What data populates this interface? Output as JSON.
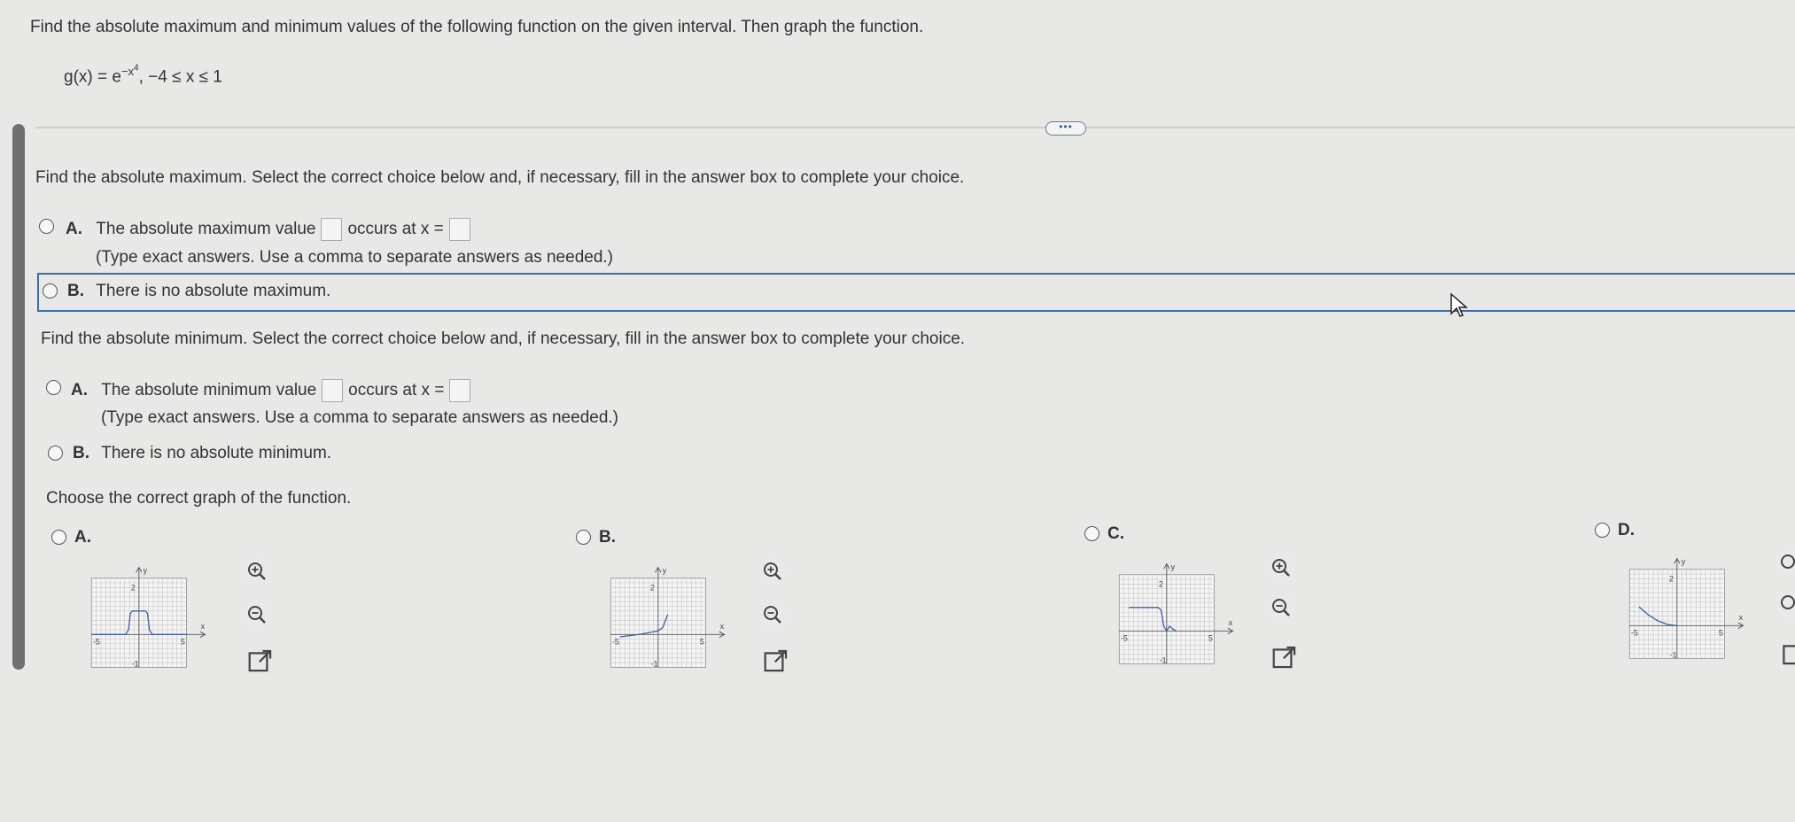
{
  "problem": {
    "instruction": "Find the absolute maximum and minimum values of the following function on the given interval. Then graph the function.",
    "function_lhs": "g(x) = e",
    "exponent": "−x",
    "exponent_power": "4",
    "interval": ", −4 ≤ x ≤ 1"
  },
  "more_button": "•••",
  "maximum": {
    "prompt": "Find the absolute maximum. Select the correct choice below and, if necessary, fill in the answer box to complete your choice.",
    "a_letter": "A.",
    "a_text1": "The absolute maximum value",
    "a_text2": "occurs at x =",
    "a_hint": "(Type exact answers. Use a comma to separate answers as needed.)",
    "b_letter": "B.",
    "b_text": "There is no absolute maximum."
  },
  "minimum": {
    "prompt": "Find the absolute minimum. Select the correct choice below and, if necessary, fill in the answer box to complete your choice.",
    "a_letter": "A.",
    "a_text1": "The absolute minimum value",
    "a_text2": "occurs at x =",
    "a_hint": "(Type exact answers. Use a comma to separate answers as needed.)",
    "b_letter": "B.",
    "b_text": "There is no absolute minimum."
  },
  "graph_prompt": "Choose the correct graph of the function.",
  "graphs": [
    {
      "letter": "A.",
      "y_top": "2",
      "y_label": "y",
      "x_label": "x",
      "x_min": "-5",
      "x_max": "5",
      "y_bottom": "-1"
    },
    {
      "letter": "B.",
      "y_top": "2",
      "y_label": "y",
      "x_label": "x",
      "x_min": "-5",
      "x_max": "5",
      "y_bottom": "-1"
    },
    {
      "letter": "C.",
      "y_top": "2",
      "y_label": "y",
      "x_label": "x",
      "x_min": "-5",
      "x_max": "5",
      "y_bottom": "-1"
    },
    {
      "letter": "D.",
      "y_top": "2",
      "y_label": "y",
      "x_label": "x",
      "x_min": "-5",
      "x_max": "5",
      "y_bottom": "-1"
    }
  ],
  "colors": {
    "accent": "#3b6ea5",
    "curve": "#3b5fa0"
  }
}
